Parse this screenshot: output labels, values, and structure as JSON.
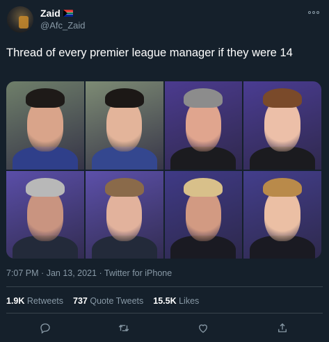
{
  "user": {
    "name": "Zaid",
    "handle": "@Afc_Zaid",
    "flag_icon": "south-africa-flag-icon"
  },
  "more_icon": "ellipsis-icon",
  "tweet": {
    "text": "Thread of every premier league manager if they were 14"
  },
  "media": {
    "panels": [
      {
        "name": "arteta-original",
        "bg": "#6f7f6a",
        "skin": "#d9a48a",
        "hair": "#1e1a18",
        "shirt": "#2f3f8a"
      },
      {
        "name": "arteta-age14",
        "bg": "#7d8b74",
        "skin": "#e3b49a",
        "hair": "#1c1816",
        "shirt": "#34478f"
      },
      {
        "name": "solskjaer-original",
        "bg": "#4b3b8f",
        "skin": "#e0a58e",
        "hair": "#8c8c8c",
        "shirt": "#1b1b1f"
      },
      {
        "name": "solskjaer-age14",
        "bg": "#4a3c92",
        "skin": "#ecbfa8",
        "hair": "#7a4a2a",
        "shirt": "#1b1b1f"
      },
      {
        "name": "mourinho-original",
        "bg": "#5a4ea8",
        "skin": "#c99480",
        "hair": "#b8b8b8",
        "shirt": "#232a3a"
      },
      {
        "name": "mourinho-age14",
        "bg": "#5c50aa",
        "skin": "#e2b29c",
        "hair": "#8a6a4a",
        "shirt": "#232a3a"
      },
      {
        "name": "klopp-original",
        "bg": "#3f3a86",
        "skin": "#d29a82",
        "hair": "#d8c08a",
        "shirt": "#1a1a22"
      },
      {
        "name": "klopp-age14",
        "bg": "#433e8c",
        "skin": "#ebbfa4",
        "hair": "#b98a4a",
        "shirt": "#1a1a22"
      }
    ]
  },
  "meta": {
    "time": "7:07 PM",
    "date": "Jan 13, 2021",
    "separator": "·",
    "source": "Twitter for iPhone"
  },
  "stats": [
    {
      "count": "1.9K",
      "label": "Retweets"
    },
    {
      "count": "737",
      "label": "Quote Tweets"
    },
    {
      "count": "15.5K",
      "label": "Likes"
    }
  ],
  "actions": [
    {
      "icon": "reply-icon"
    },
    {
      "icon": "retweet-icon"
    },
    {
      "icon": "like-icon"
    },
    {
      "icon": "share-icon"
    }
  ]
}
